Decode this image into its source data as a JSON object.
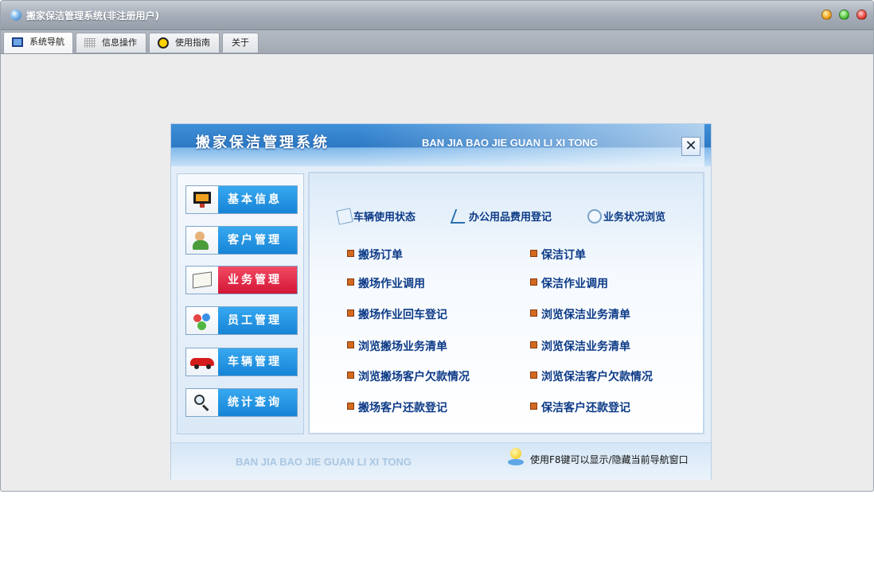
{
  "window": {
    "title": "搬家保洁管理系统(非注册用户)",
    "icon": "app-icon"
  },
  "tabs": [
    {
      "label": "系统导航",
      "icon": "monitor-icon",
      "active": true
    },
    {
      "label": "信息操作",
      "icon": "grid-icon",
      "active": false
    },
    {
      "label": "使用指南",
      "icon": "clock-icon",
      "active": false
    },
    {
      "label": "关于",
      "icon": "",
      "active": false
    }
  ],
  "dialog": {
    "title": "搬家保洁管理系统",
    "subtitle": "BAN JIA BAO JIE GUAN LI XI TONG",
    "close_glyph": "✕",
    "nav": [
      {
        "label": "基本信息",
        "icon": "monitor-icon",
        "active": false
      },
      {
        "label": "客户管理",
        "icon": "person-icon",
        "active": false
      },
      {
        "label": "业务管理",
        "icon": "book-icon",
        "active": true
      },
      {
        "label": "员工管理",
        "icon": "people-icon",
        "active": false
      },
      {
        "label": "车辆管理",
        "icon": "car-icon",
        "active": false
      },
      {
        "label": "统计查询",
        "icon": "magnifier-icon",
        "active": false
      }
    ],
    "quick_links": [
      {
        "label": "车辆使用状态",
        "icon": "document-icon"
      },
      {
        "label": "办公用品费用登记",
        "icon": "pencil-icon"
      },
      {
        "label": "业务状况浏览",
        "icon": "search-icon"
      }
    ],
    "left_links": [
      "搬场订单",
      "搬场作业调用",
      "搬场作业回车登记",
      "浏览搬场业务清单",
      "浏览搬场客户欠款情况",
      "搬场客户还款登记"
    ],
    "right_links": [
      "保洁订单",
      "保洁作业调用",
      "浏览保洁业务清单",
      "浏览保洁业务清单",
      "浏览保洁客户欠款情况",
      "保洁客户还款登记"
    ],
    "footer": {
      "subtitle": "BAN JIA BAO JIE GUAN LI XI TONG",
      "tip": "使用F8键可以显示/隐藏当前导航窗口",
      "tip_icon": "lightbulb-icon"
    }
  }
}
